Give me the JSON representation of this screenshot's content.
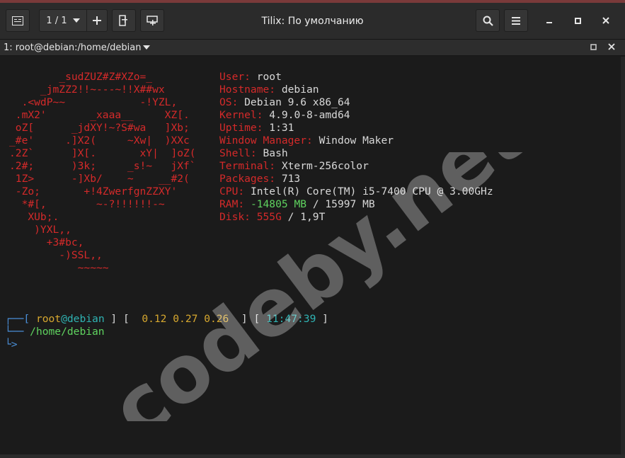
{
  "window": {
    "title": "Tilix: По умолчанию",
    "session_count": "1 / 1"
  },
  "terminal": {
    "title": "1: root@debian:/home/debian"
  },
  "ascii_art": [
    "        _sudZUZ#Z#XZo=_",
    "     _jmZZ2!!~---~!!X##wx",
    "  .<wdP~~            -!YZL,",
    " .mX2'       _xaaa__     XZ[.",
    " oZ[      _jdXY!~?S#wa   ]Xb;",
    "_#e'     .]X2(     ~Xw|  )XXc",
    ".2Z`      ]X[.       xY|  ]oZ(",
    ".2#;      )3k;     _s!~   jXf`",
    " 1Z>      -]Xb/    ~    __#2(",
    " -Zo;       +!4ZwerfgnZZXY'",
    "  *#[,        ~-?!!!!!!-~",
    "   XUb;.",
    "    )YXL,,",
    "      +3#bc,",
    "        -)SSL,,",
    "           ~~~~~"
  ],
  "sysinfo": [
    {
      "key": "User:",
      "value": " root"
    },
    {
      "key": "Hostname:",
      "value": " debian"
    },
    {
      "key": "OS:",
      "value": " Debian 9.6 x86_64"
    },
    {
      "key": "Kernel:",
      "value": " 4.9.0-8-amd64"
    },
    {
      "key": "Uptime:",
      "value": " 1:31"
    },
    {
      "key": "Window Manager:",
      "value": " Window Maker"
    },
    {
      "key": "Shell:",
      "value": " Bash"
    },
    {
      "key": "Terminal:",
      "value": " Xterm-256color"
    },
    {
      "key": "Packages:",
      "value": " 713"
    },
    {
      "key": "CPU:",
      "value": " Intel(R) Core(TM) i5-7400 CPU @ 3.00GHz"
    }
  ],
  "ram": {
    "key": "RAM:",
    "used": " -14805 MB",
    "sep": " / ",
    "total": "15997 MB"
  },
  "disk": {
    "key": "Disk:",
    "used": " 555G",
    "sep": " / ",
    "total": "1,9T"
  },
  "prompt": {
    "line1_a": "┌──[ ",
    "user": "root",
    "at": "@",
    "host": "debian",
    "line1_b": " ] [  ",
    "load": "0.12 0.27 0.26",
    "line1_c": "  ] [ ",
    "time": "11:47:39",
    "line1_d": " ]",
    "line2_a": "└── ",
    "path": "/home/debian",
    "line3": "└>"
  },
  "watermark": "codeby.net",
  "colors": {
    "header_bg": "#2b2b2b",
    "terminal_bg": "#1b1b1b",
    "accent_red": "#d42a2a",
    "green": "#5fd35f",
    "yellow": "#d7a82f",
    "cyan": "#2fb3b3",
    "blue": "#4a8fd8"
  }
}
